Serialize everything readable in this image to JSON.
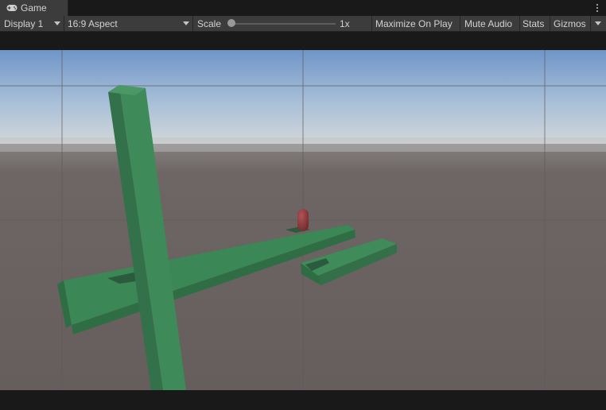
{
  "tab": {
    "title": "Game",
    "icon": "gamepad-icon"
  },
  "toolbar": {
    "display_label": "Display 1",
    "aspect_label": "16:9 Aspect",
    "scale_label": "Scale",
    "scale_value": "1x",
    "scale_slider_fraction": 0.0,
    "maximize_label": "Maximize On Play",
    "mute_label": "Mute Audio",
    "stats_label": "Stats",
    "gizmos_label": "Gizmos"
  },
  "scene": {
    "sky_top": "#6f95c8",
    "sky_horizon": "#d5d8d9",
    "ground": "#6a6361",
    "platform_color": "#3e8a58",
    "player_color": "#8c3a3c"
  }
}
